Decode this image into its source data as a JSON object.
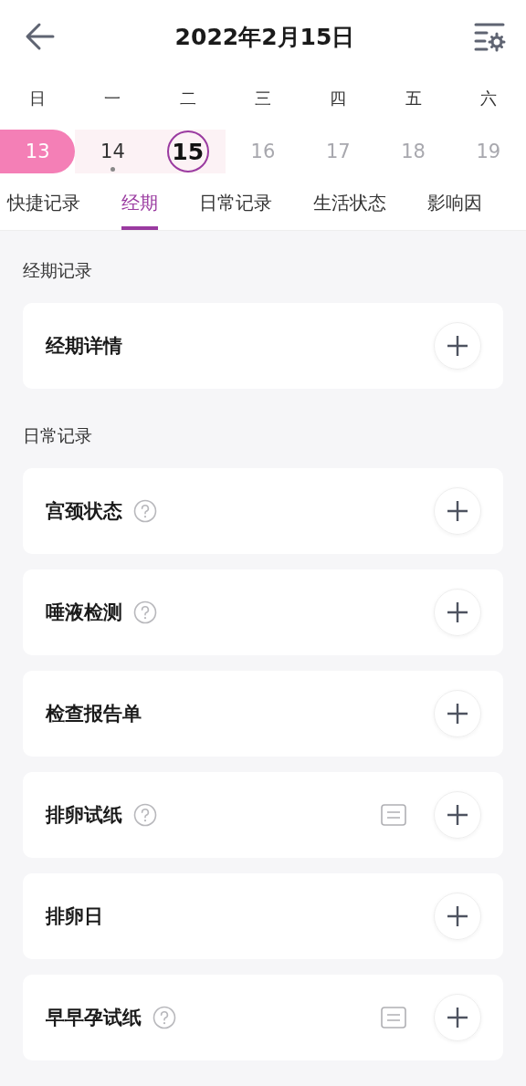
{
  "header": {
    "title": "2022年2月15日"
  },
  "calendar": {
    "weekdays": [
      "日",
      "一",
      "二",
      "三",
      "四",
      "五",
      "六"
    ],
    "days": [
      {
        "label": "13",
        "selected": false,
        "kind": "period",
        "dot": false,
        "disabled": false
      },
      {
        "label": "14",
        "selected": false,
        "kind": "light",
        "dot": true,
        "disabled": false
      },
      {
        "label": "15",
        "selected": true,
        "kind": "light",
        "dot": false,
        "disabled": false
      },
      {
        "label": "16",
        "selected": false,
        "kind": "none",
        "dot": false,
        "disabled": true
      },
      {
        "label": "17",
        "selected": false,
        "kind": "none",
        "dot": false,
        "disabled": true
      },
      {
        "label": "18",
        "selected": false,
        "kind": "none",
        "dot": false,
        "disabled": true
      },
      {
        "label": "19",
        "selected": false,
        "kind": "none",
        "dot": false,
        "disabled": true
      }
    ]
  },
  "tabs": [
    {
      "label": "快捷记录",
      "selected": false
    },
    {
      "label": "经期",
      "selected": true
    },
    {
      "label": "日常记录",
      "selected": false
    },
    {
      "label": "生活状态",
      "selected": false
    },
    {
      "label": "影响因",
      "selected": false
    }
  ],
  "sections": [
    {
      "title": "经期记录",
      "items": [
        {
          "name": "经期详情",
          "help": false,
          "note": false
        }
      ]
    },
    {
      "title": "日常记录",
      "items": [
        {
          "name": "宫颈状态",
          "help": true,
          "note": false
        },
        {
          "name": "唾液检测",
          "help": true,
          "note": false
        },
        {
          "name": "检查报告单",
          "help": false,
          "note": false
        },
        {
          "name": "排卵试纸",
          "help": true,
          "note": true
        },
        {
          "name": "排卵日",
          "help": false,
          "note": false
        },
        {
          "name": "早早孕试纸",
          "help": true,
          "note": true
        }
      ]
    }
  ]
}
